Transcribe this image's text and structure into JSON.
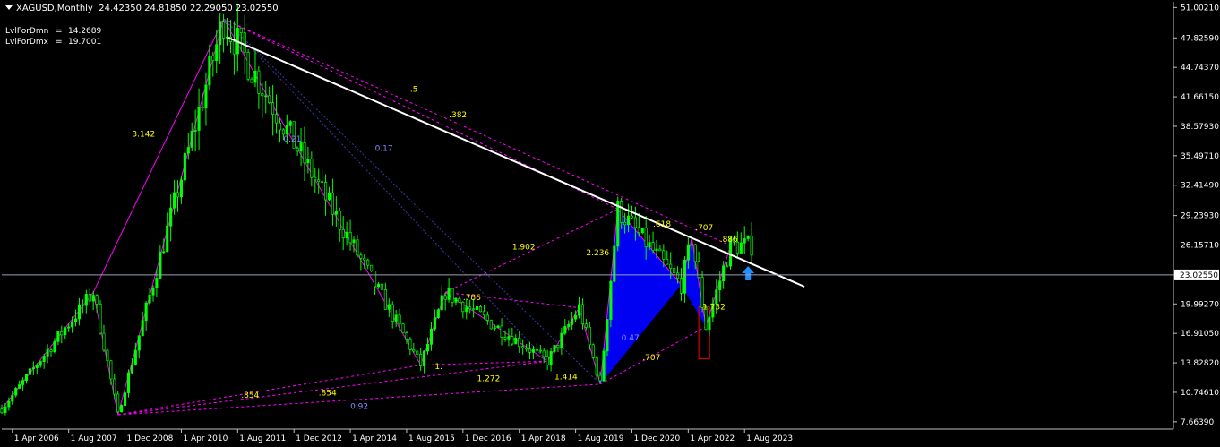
{
  "header": {
    "symbol": "XAGUSD,Monthly",
    "ohlc": "24.42350 24.81850 22.29050 23.02550"
  },
  "indicators": [
    {
      "label": "LvlForDmn",
      "value": "14.2689"
    },
    {
      "label": "LvlForDmx",
      "value": "19.7001"
    }
  ],
  "colors": {
    "background": "#000000",
    "candle": "#00ff00",
    "pattern_lines": "#ff00ff",
    "pattern_fill": "#0000ff",
    "trendline": "#ffffff",
    "ratio_labels": "#ffff00",
    "arrow": "#1e90ff",
    "box": "#ff0000",
    "grid_axis": "#c0c0c0"
  },
  "chart_data": {
    "type": "candlestick",
    "symbol": "XAGUSD",
    "timeframe": "Monthly",
    "last_price": 23.0255,
    "y_ticks": [
      7.6639,
      10.7461,
      13.8282,
      16.9105,
      19.9927,
      23.0255,
      26.1571,
      29.2393,
      32.4149,
      35.4971,
      38.5793,
      41.6615,
      44.7437,
      47.8259,
      51.0021
    ],
    "y_tick_labels": [
      "7.66390",
      "10.74610",
      "13.82820",
      "16.91050",
      "19.99270",
      "23.02550",
      "26.15710",
      "29.23930",
      "32.41490",
      "35.49710",
      "38.57930",
      "41.66150",
      "44.74370",
      "47.82590",
      "51.00210"
    ],
    "ylim": [
      6.9,
      51.6
    ],
    "x_tick_labels": [
      "1 Apr 2006",
      "1 Aug 2007",
      "1 Dec 2008",
      "1 Apr 2010",
      "1 Aug 2011",
      "1 Dec 2012",
      "1 Apr 2014",
      "1 Aug 2015",
      "1 Dec 2016",
      "1 Apr 2018",
      "1 Aug 2019",
      "1 Dec 2020",
      "1 Apr 2022",
      "1 Aug 2023"
    ],
    "x_tick_dates": [
      "2006-04",
      "2007-08",
      "2008-12",
      "2010-04",
      "2011-08",
      "2012-12",
      "2014-04",
      "2015-08",
      "2016-12",
      "2018-04",
      "2019-08",
      "2020-12",
      "2022-04",
      "2023-08"
    ],
    "pattern_points": [
      {
        "date": "2006-01",
        "price": 9.0
      },
      {
        "date": "2008-03",
        "price": 21.2
      },
      {
        "date": "2008-10",
        "price": 8.4
      },
      {
        "date": "2011-04",
        "price": 49.8
      },
      {
        "date": "2015-12",
        "price": 13.6
      },
      {
        "date": "2016-07",
        "price": 21.2
      },
      {
        "date": "2018-12",
        "price": 14.0
      },
      {
        "date": "2019-09",
        "price": 19.6
      },
      {
        "date": "2020-03",
        "price": 11.6
      },
      {
        "date": "2020-08",
        "price": 29.9
      },
      {
        "date": "2022-02",
        "price": 22.0
      },
      {
        "date": "2022-05",
        "price": 26.9
      },
      {
        "date": "2022-09",
        "price": 17.6
      },
      {
        "date": "2023-04",
        "price": 26.1
      }
    ],
    "trendline": [
      {
        "date": "2011-05",
        "price": 47.9
      },
      {
        "date": "2025-01",
        "price": 21.8
      }
    ],
    "ratio_labels": [
      {
        "text": "3.142",
        "date": "2009-02",
        "price": 37.5,
        "color": "#ffff00"
      },
      {
        "text": "0.21",
        "date": "2012-09",
        "price": 37.0,
        "color": "#8a8aff"
      },
      {
        "text": "0.17",
        "date": "2014-11",
        "price": 36.0,
        "color": "#8a8aff"
      },
      {
        "text": ".5",
        "date": "2015-09",
        "price": 42.2,
        "color": "#ffff00"
      },
      {
        "text": ".382",
        "date": "2016-08",
        "price": 39.5,
        "color": "#ffff00"
      },
      {
        "text": ".618",
        "date": "2021-06",
        "price": 28.1,
        "color": "#ffff00"
      },
      {
        "text": ".707",
        "date": "2022-06",
        "price": 27.7,
        "color": "#ffff00"
      },
      {
        "text": ".886",
        "date": "2023-01",
        "price": 26.5,
        "color": "#ffff00"
      },
      {
        "text": "1.902",
        "date": "2018-02",
        "price": 25.7,
        "color": "#ffff00"
      },
      {
        "text": "2.236",
        "date": "2019-11",
        "price": 25.1,
        "color": "#ffff00"
      },
      {
        "text": ".786",
        "date": "2016-12",
        "price": 20.4,
        "color": "#ffff00"
      },
      {
        "text": "1.732",
        "date": "2022-08",
        "price": 19.4,
        "color": "#ffff00"
      },
      {
        "text": "0.47",
        "date": "2020-09",
        "price": 16.2,
        "color": "#8a8aff"
      },
      {
        "text": ".707",
        "date": "2021-03",
        "price": 14.1,
        "color": "#ffff00"
      },
      {
        "text": "1.",
        "date": "2016-04",
        "price": 13.2,
        "color": "#ffff00"
      },
      {
        "text": "1.272",
        "date": "2017-04",
        "price": 11.9,
        "color": "#ffff00"
      },
      {
        "text": "1.414",
        "date": "2019-02",
        "price": 12.1,
        "color": "#ffff00"
      },
      {
        "text": ".854",
        "date": "2011-09",
        "price": 10.2,
        "color": "#ffff00"
      },
      {
        "text": ".854",
        "date": "2013-07",
        "price": 10.4,
        "color": "#ffff00"
      },
      {
        "text": "0.92",
        "date": "2014-04",
        "price": 9.0,
        "color": "#8a8aff"
      }
    ]
  }
}
